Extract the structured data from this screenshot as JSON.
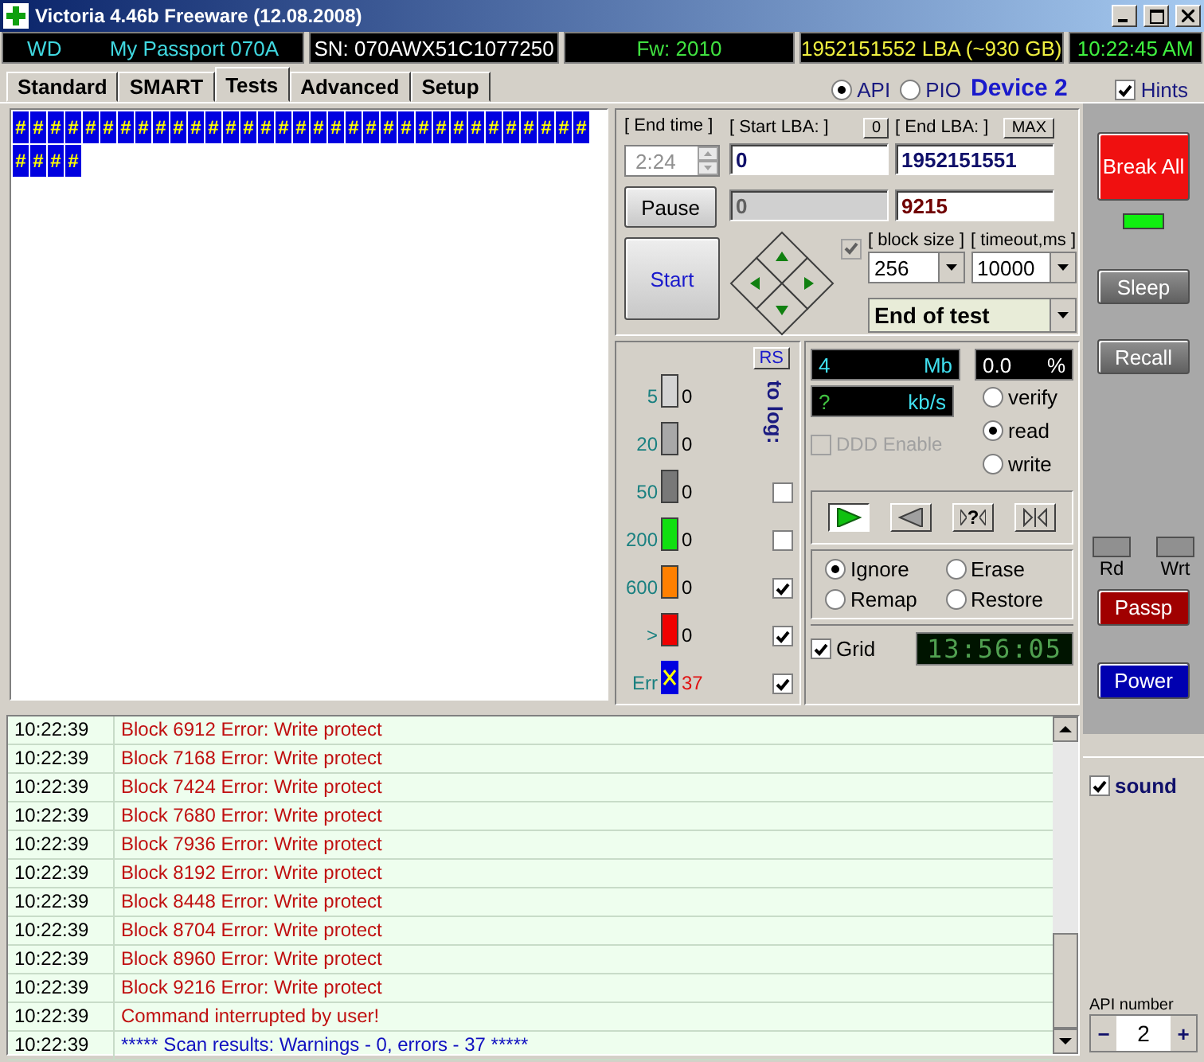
{
  "window": {
    "title": "Victoria 4.46b Freeware (12.08.2008)"
  },
  "info_bar": [
    {
      "parts": [
        "WD",
        "My Passport 070A"
      ],
      "color": "#40d8e0"
    },
    {
      "parts": [
        "SN: 070AWX51C1077250"
      ],
      "color": "#ffffff"
    },
    {
      "parts": [
        "Fw: 2010"
      ],
      "color": "#40e040"
    },
    {
      "parts": [
        "1952151552 LBA (~930 GB)"
      ],
      "color": "#f0f040"
    },
    {
      "parts": [
        "10:22:45 AM"
      ],
      "color": "#40f040"
    }
  ],
  "tabs": [
    {
      "label": "Standard",
      "selected": false
    },
    {
      "label": "SMART",
      "selected": false
    },
    {
      "label": "Tests",
      "selected": true
    },
    {
      "label": "Advanced",
      "selected": false
    },
    {
      "label": "Setup",
      "selected": false
    }
  ],
  "api_mode": [
    {
      "label": "API",
      "selected": true
    },
    {
      "label": "PIO",
      "selected": false
    }
  ],
  "device": "Device 2",
  "hints": {
    "label": "Hints",
    "checked": true
  },
  "grid_blocks": [
    "#",
    "#",
    "#",
    "#",
    "#",
    "#",
    "#",
    "#",
    "#",
    "#",
    "#",
    "#",
    "#",
    "#",
    "#",
    "#",
    "#",
    "#",
    "#",
    "#",
    "#",
    "#",
    "#",
    "#",
    "#",
    "#",
    "#",
    "#",
    "#",
    "#",
    "#",
    "#",
    "#",
    "#",
    "#",
    "#",
    "#"
  ],
  "test_panel": {
    "end_time_label": "[ End time ]",
    "end_time": "2:24",
    "start_lba_label": "[ Start LBA: ]",
    "start_reset": "0",
    "start_lba": "0",
    "end_lba_label": "[ End LBA: ]",
    "end_max": "MAX",
    "end_lba": "1952151551",
    "current_lba": "0",
    "current_block": "9215",
    "pause": "Pause",
    "start": "Start",
    "nav_check": {
      "checked": true,
      "disabled": true
    },
    "block_size_label": "[ block size ]",
    "block_size": "256",
    "timeout_label": "[ timeout,ms ]",
    "timeout": "10000",
    "finish_action": "End of test"
  },
  "counters": {
    "reset": "RS",
    "to_log": "to log:",
    "rows": [
      {
        "kind": "bar",
        "label": "5",
        "count": "0",
        "color": "#d4d4d4"
      },
      {
        "kind": "bar",
        "label": "20",
        "count": "0",
        "color": "#a8a8a8"
      },
      {
        "kind": "bar",
        "label": "50",
        "count": "0",
        "color": "#787878",
        "logged": false
      },
      {
        "kind": "bar",
        "label": "200",
        "count": "0",
        "color": "#10e010",
        "logged": false
      },
      {
        "kind": "bar",
        "label": "600",
        "count": "0",
        "color": "#ff8000",
        "logged": true
      },
      {
        "kind": "bar",
        "label": ">",
        "count": "0",
        "color": "#f00000",
        "logged": true
      },
      {
        "kind": "error",
        "label": "Err",
        "count": "37",
        "color": "#0000e0",
        "logged": true
      }
    ]
  },
  "stats": {
    "size": "4",
    "size_unit": "Mb",
    "percent": "0.0",
    "percent_unit": "%",
    "speed": "?",
    "speed_unit": "kb/s",
    "ddd": {
      "label": "DDD Enable",
      "checked": false,
      "disabled": true
    },
    "modes": [
      {
        "label": "verify",
        "selected": false
      },
      {
        "label": "read",
        "selected": true
      },
      {
        "label": "write",
        "selected": false
      }
    ],
    "direction": [
      {
        "kind": "forward",
        "selected": true
      },
      {
        "kind": "backward",
        "selected": false
      },
      {
        "kind": "random",
        "label": "?",
        "selected": false
      },
      {
        "kind": "butterfly",
        "selected": false
      }
    ],
    "actions": [
      {
        "label": "Ignore",
        "selected": true
      },
      {
        "label": "Erase",
        "selected": false
      },
      {
        "label": "Remap",
        "selected": false
      },
      {
        "label": "Restore",
        "selected": false
      }
    ],
    "grid": {
      "label": "Grid",
      "checked": true
    },
    "timer": "13:56:05"
  },
  "sidebar": {
    "break_all": "Break All",
    "led_on": true,
    "sleep": "Sleep",
    "recall": "Recall",
    "rd": "Rd",
    "wrt": "Wrt",
    "passp": "Passp",
    "power": "Power",
    "sound": {
      "label": "sound",
      "checked": true
    },
    "api_number_label": "API number",
    "api_number": "2",
    "minus": "−",
    "plus": "+"
  },
  "log": [
    {
      "time": "10:22:39",
      "message": "Block 6912 Error: Write protect",
      "kind": "error"
    },
    {
      "time": "10:22:39",
      "message": "Block 7168 Error: Write protect",
      "kind": "error"
    },
    {
      "time": "10:22:39",
      "message": "Block 7424 Error: Write protect",
      "kind": "error"
    },
    {
      "time": "10:22:39",
      "message": "Block 7680 Error: Write protect",
      "kind": "error"
    },
    {
      "time": "10:22:39",
      "message": "Block 7936 Error: Write protect",
      "kind": "error"
    },
    {
      "time": "10:22:39",
      "message": "Block 8192 Error: Write protect",
      "kind": "error"
    },
    {
      "time": "10:22:39",
      "message": "Block 8448 Error: Write protect",
      "kind": "error"
    },
    {
      "time": "10:22:39",
      "message": "Block 8704 Error: Write protect",
      "kind": "error"
    },
    {
      "time": "10:22:39",
      "message": "Block 8960 Error: Write protect",
      "kind": "error"
    },
    {
      "time": "10:22:39",
      "message": "Block 9216 Error: Write protect",
      "kind": "error"
    },
    {
      "time": "10:22:39",
      "message": "Command interrupted by user!",
      "kind": "error"
    },
    {
      "time": "10:22:39",
      "message": "***** Scan results: Warnings - 0, errors - 37 *****",
      "kind": "info"
    }
  ]
}
